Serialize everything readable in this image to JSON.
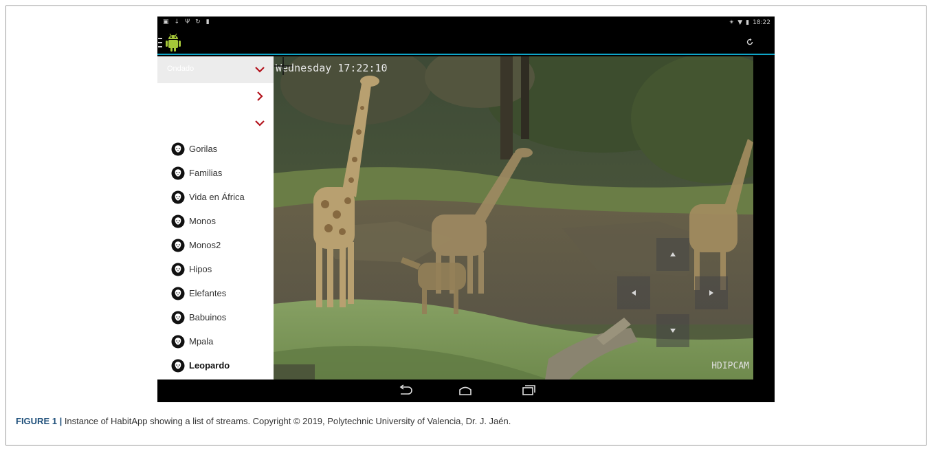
{
  "status_bar": {
    "time": "18:22"
  },
  "side_list": {
    "sections": [
      {
        "label": "Ondado",
        "state": "expanded"
      },
      {
        "label": "",
        "state": "collapsed"
      },
      {
        "label": "",
        "state": "expanded"
      }
    ],
    "streams": [
      {
        "label": "Gorilas"
      },
      {
        "label": "Familias"
      },
      {
        "label": "Vida en África"
      },
      {
        "label": "Monos"
      },
      {
        "label": "Monos2"
      },
      {
        "label": "Hipos"
      },
      {
        "label": "Elefantes"
      },
      {
        "label": "Babuinos"
      },
      {
        "label": "Mpala"
      },
      {
        "label": "Leopardo"
      }
    ]
  },
  "video": {
    "timestamp": "Wednesday 17:22:10",
    "brand": "HDIPCAM"
  },
  "caption": {
    "label": "FIGURE 1 |",
    "text": " Instance of HabitApp showing a list of streams. Copyright © 2019, Polytechnic University of Valencia, Dr. J. Jaén."
  },
  "colors": {
    "accent": "#0fa6c8",
    "chevron": "#b3121c",
    "figure_label": "#1e4f7a"
  },
  "icons": [
    "menu-icon",
    "android-logo",
    "refresh-icon",
    "chevron-down-icon",
    "chevron-right-icon",
    "lion-icon",
    "back-icon",
    "home-icon",
    "recents-icon",
    "crosshair-icon"
  ]
}
